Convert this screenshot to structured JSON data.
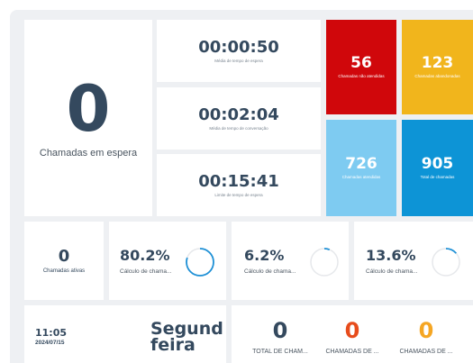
{
  "waiting": {
    "count": "0",
    "label": "Chamadas em espera"
  },
  "times": [
    {
      "value": "00:00:50",
      "caption": "Média de tempo de espera"
    },
    {
      "value": "00:02:04",
      "caption": "Média de tempo de conversação"
    },
    {
      "value": "00:15:41",
      "caption": "Limite de tempo de espera"
    }
  ],
  "tiles": [
    {
      "value": "56",
      "caption": "Chamadas não atendidas",
      "color": "#d0070b"
    },
    {
      "value": "123",
      "caption": "Chamadas abandonadas",
      "color": "#f1b51c"
    },
    {
      "value": "726",
      "caption": "Chamadas atendidas",
      "color": "#7ecbf1"
    },
    {
      "value": "905",
      "caption": "Total de chamadas",
      "color": "#0d94d6"
    }
  ],
  "active": {
    "count": "0",
    "label": "Chamadas ativas"
  },
  "percentages": [
    {
      "value": "80.2%",
      "caption": "Cálculo de chama...",
      "fraction": 0.802
    },
    {
      "value": "6.2%",
      "caption": "Cálculo de chama...",
      "fraction": 0.062
    },
    {
      "value": "13.6%",
      "caption": "Cálculo de chama...",
      "fraction": 0.136
    }
  ],
  "clock": {
    "time": "11:05",
    "date": "2024/07/15",
    "weekday_line1": "Segund",
    "weekday_line2": "feira"
  },
  "counters": [
    {
      "value": "0",
      "caption": "TOTAL DE CHAM...",
      "color": "#34495e"
    },
    {
      "value": "0",
      "caption": "CHAMADAS DE ...",
      "color": "#e74c1c"
    },
    {
      "value": "0",
      "caption": "CHAMADAS DE ...",
      "color": "#f5a623"
    }
  ],
  "colors": {
    "donut_arc": "#1e90d6",
    "donut_track": "#e6e8eb"
  }
}
